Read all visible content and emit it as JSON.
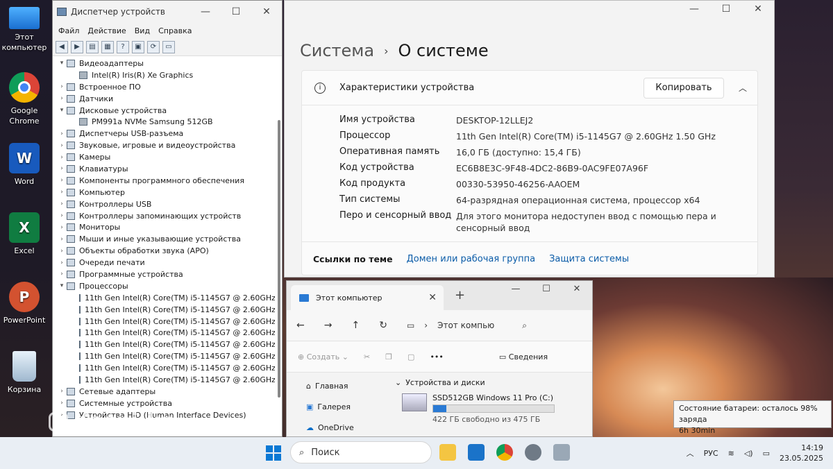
{
  "desktop": {
    "icons": [
      {
        "label": "Этот компьютер"
      },
      {
        "label": "Google Chrome"
      },
      {
        "label": "Word"
      },
      {
        "label": "Excel"
      },
      {
        "label": "PowerPoint"
      },
      {
        "label": "Корзина"
      }
    ]
  },
  "device_manager": {
    "title": "Диспетчер устройств",
    "menu": [
      "Файл",
      "Действие",
      "Вид",
      "Справка"
    ],
    "tree": [
      {
        "label": "Видеоадаптеры",
        "expanded": true
      },
      {
        "label": "Intel(R) Iris(R) Xe Graphics",
        "child": true
      },
      {
        "label": "Встроенное ПО"
      },
      {
        "label": "Датчики"
      },
      {
        "label": "Дисковые устройства",
        "expanded": true
      },
      {
        "label": "PM991a NVMe Samsung 512GB",
        "child": true
      },
      {
        "label": "Диспетчеры USB-разъема"
      },
      {
        "label": "Звуковые, игровые и видеоустройства"
      },
      {
        "label": "Камеры"
      },
      {
        "label": "Клавиатуры"
      },
      {
        "label": "Компоненты программного обеспечения"
      },
      {
        "label": "Компьютер"
      },
      {
        "label": "Контроллеры USB"
      },
      {
        "label": "Контроллеры запоминающих устройств"
      },
      {
        "label": "Мониторы"
      },
      {
        "label": "Мыши и иные указывающие устройства"
      },
      {
        "label": "Объекты обработки звука (APO)"
      },
      {
        "label": "Очереди печати"
      },
      {
        "label": "Программные устройства"
      },
      {
        "label": "Процессоры",
        "expanded": true
      },
      {
        "label": "11th Gen Intel(R) Core(TM) i5-1145G7 @ 2.60GHz",
        "child": true
      },
      {
        "label": "11th Gen Intel(R) Core(TM) i5-1145G7 @ 2.60GHz",
        "child": true
      },
      {
        "label": "11th Gen Intel(R) Core(TM) i5-1145G7 @ 2.60GHz",
        "child": true
      },
      {
        "label": "11th Gen Intel(R) Core(TM) i5-1145G7 @ 2.60GHz",
        "child": true
      },
      {
        "label": "11th Gen Intel(R) Core(TM) i5-1145G7 @ 2.60GHz",
        "child": true
      },
      {
        "label": "11th Gen Intel(R) Core(TM) i5-1145G7 @ 2.60GHz",
        "child": true
      },
      {
        "label": "11th Gen Intel(R) Core(TM) i5-1145G7 @ 2.60GHz",
        "child": true
      },
      {
        "label": "11th Gen Intel(R) Core(TM) i5-1145G7 @ 2.60GHz",
        "child": true
      },
      {
        "label": "Сетевые адаптеры"
      },
      {
        "label": "Системные устройства"
      },
      {
        "label": "Устройства HID (Human Interface Devices)"
      }
    ]
  },
  "settings": {
    "breadcrumb_parent": "Система",
    "breadcrumb_current": "О системе",
    "section_title": "Характеристики устройства",
    "copy_label": "Копировать",
    "specs": [
      {
        "name": "Имя устройства",
        "value": "DESKTOP-12LLEJ2"
      },
      {
        "name": "Процессор",
        "value": "11th Gen Intel(R) Core(TM) i5-1145G7 @ 2.60GHz   1.50 GHz"
      },
      {
        "name": "Оперативная память",
        "value": "16,0 ГБ (доступно: 15,4 ГБ)"
      },
      {
        "name": "Код устройства",
        "value": "EC6B8E3C-9F48-4DC2-86B9-0AC9FE07A96F"
      },
      {
        "name": "Код продукта",
        "value": "00330-53950-46256-AAOEM"
      },
      {
        "name": "Тип системы",
        "value": "64-разрядная операционная система, процессор x64"
      },
      {
        "name": "Перо и сенсорный ввод",
        "value": "Для этого монитора недоступен ввод с помощью пера и сенсорный ввод"
      }
    ],
    "links_label": "Ссылки по теме",
    "links": [
      "Домен или рабочая группа",
      "Защита системы"
    ]
  },
  "explorer": {
    "tab_title": "Этот компьютер",
    "address": "Этот компью",
    "create_label": "Создать",
    "details_label": "Сведения",
    "sidebar": [
      "Главная",
      "Галерея",
      "OneDrive"
    ],
    "group_label": "Устройства и диски",
    "drive_name": "SSD512GB Windows 11 Pro (C:)",
    "drive_free": "422 ГБ свободно из 475 ГБ",
    "drive_used_fraction": 0.11
  },
  "tooltip": {
    "line1": "Состояние батареи: осталось 98% заряда",
    "line2": "6h 30min"
  },
  "watermark": "Kaspi.kz",
  "taskbar": {
    "search_placeholder": "Поиск",
    "lang": "РУС",
    "time": "14:19",
    "date": "23.05.2025"
  }
}
